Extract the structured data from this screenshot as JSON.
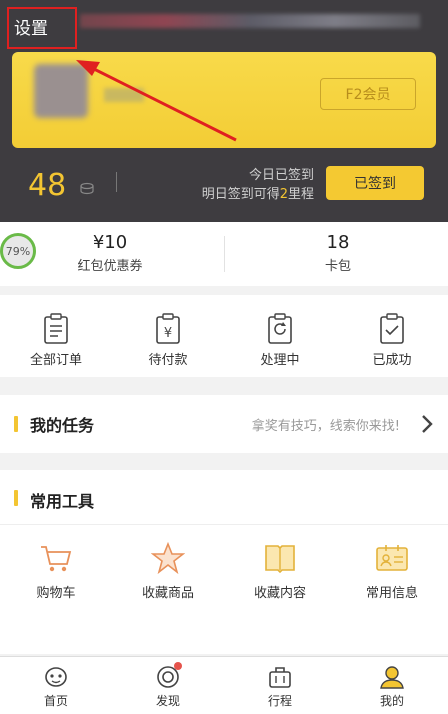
{
  "header": {
    "settings_label": "设置",
    "member_badge": "F2会员",
    "points": "48",
    "signin_line1": "今日已签到",
    "signin_line2_prefix": "明日签到可得",
    "signin_line2_number": "2",
    "signin_line2_suffix": "里程",
    "signed_button": "已签到"
  },
  "stats": {
    "percent": "79%",
    "items": [
      {
        "value": "¥10",
        "label": "红包优惠券"
      },
      {
        "value": "18",
        "label": "卡包"
      }
    ]
  },
  "orders": [
    {
      "label": "全部订单",
      "icon": "clipboard-list-icon"
    },
    {
      "label": "待付款",
      "icon": "yuan-receipt-icon"
    },
    {
      "label": "处理中",
      "icon": "refresh-doc-icon"
    },
    {
      "label": "已成功",
      "icon": "check-doc-icon"
    }
  ],
  "task": {
    "title": "我的任务",
    "hint": "拿奖有技巧，线索你来找!"
  },
  "tools": {
    "title": "常用工具",
    "items": [
      {
        "label": "购物车",
        "icon": "cart-icon"
      },
      {
        "label": "收藏商品",
        "icon": "star-icon"
      },
      {
        "label": "收藏内容",
        "icon": "book-icon"
      },
      {
        "label": "常用信息",
        "icon": "id-card-icon"
      }
    ]
  },
  "tabbar": [
    {
      "label": "首页",
      "icon": "home-icon"
    },
    {
      "label": "发现",
      "icon": "discover-icon"
    },
    {
      "label": "行程",
      "icon": "luggage-icon"
    },
    {
      "label": "我的",
      "icon": "profile-icon"
    }
  ],
  "colors": {
    "accent": "#f3c532",
    "header_bg": "#3e3c40",
    "annotation_red": "#e02020"
  }
}
